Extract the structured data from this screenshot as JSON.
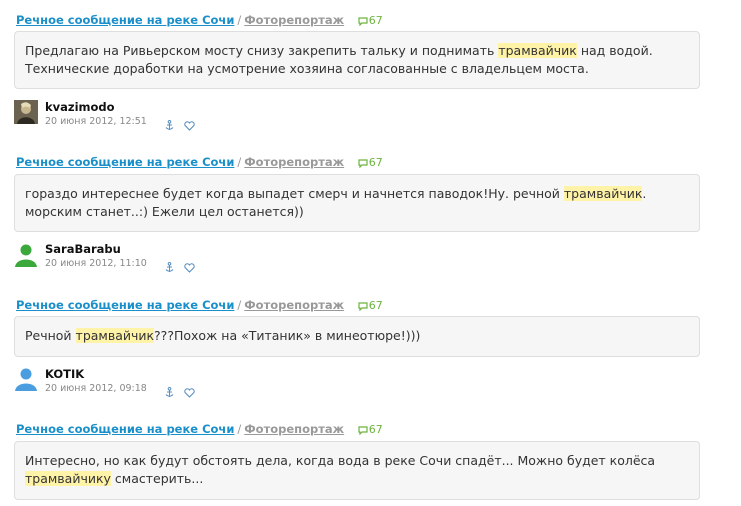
{
  "comments": [
    {
      "post_title": "Речное сообщение на реке Сочи",
      "blog": "Фоторепортаж",
      "count": "67",
      "text_before": "Предлагаю на Ривьерском мосту снизу закрепить тальку и поднимать ",
      "highlight": "трамвайчик",
      "text_after": " над водой. Технические доработки на усмотрение хозяина согласованные с владельцем моста.",
      "author": "kvazimodo",
      "date": "20 июня 2012, 12:51",
      "avatar": "photo"
    },
    {
      "post_title": "Речное сообщение на реке Сочи",
      "blog": "Фоторепортаж",
      "count": "67",
      "text_before": "гораздо интереснее будет когда выпадет смерч и начнется паводок!Ну. речной ",
      "highlight": "трамвайчик",
      "text_after": ". морским станет..:) Ежели цел останется))",
      "author": "SaraBarabu",
      "date": "20 июня 2012, 11:10",
      "avatar": "green-user"
    },
    {
      "post_title": "Речное сообщение на реке Сочи",
      "blog": "Фоторепортаж",
      "count": "67",
      "text_before": "Речной ",
      "highlight": "трамвайчик",
      "text_after": "???Похож на «Титаник» в минеотюре!)))",
      "author": "KOTIK",
      "date": "20 июня 2012, 09:18",
      "avatar": "blue-user"
    },
    {
      "post_title": "Речное сообщение на реке Сочи",
      "blog": "Фоторепортаж",
      "count": "67",
      "text_before": "Интересно, но как будут обстоять дела, когда вода в реке Сочи спадёт... Можно будет колёса ",
      "highlight": "трамвайчику",
      "text_after": " смастерить...",
      "author": "",
      "date": "",
      "avatar": ""
    }
  ],
  "colors": {
    "link": "#1a8fc9",
    "count": "#6db33f",
    "highlight": "#fff3a8",
    "bubble": "#f6f6f6"
  }
}
